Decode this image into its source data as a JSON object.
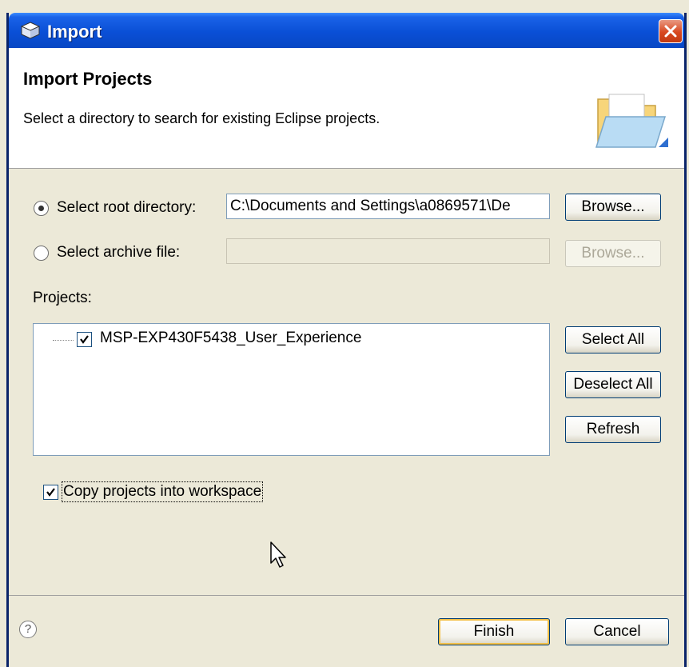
{
  "window": {
    "title": "Import",
    "close_label": "×"
  },
  "header": {
    "title": "Import Projects",
    "description": "Select a directory to search for existing Eclipse projects."
  },
  "source": {
    "root_directory": {
      "label": "Select root directory:",
      "selected": true,
      "value": "C:\\Documents and Settings\\a0869571\\De",
      "browse_label": "Browse..."
    },
    "archive_file": {
      "label": "Select archive file:",
      "selected": false,
      "value": "",
      "browse_label": "Browse..."
    }
  },
  "projects": {
    "label": "Projects:",
    "items": [
      {
        "name": "MSP-EXP430F5438_User_Experience",
        "checked": true
      }
    ],
    "select_all_label": "Select All",
    "deselect_all_label": "Deselect All",
    "refresh_label": "Refresh"
  },
  "options": {
    "copy_into_workspace": {
      "label": "Copy projects into workspace",
      "checked": true
    }
  },
  "footer": {
    "help_label": "?",
    "finish_label": "Finish",
    "cancel_label": "Cancel"
  },
  "icons": {
    "title": "import-wizard-icon",
    "close": "close-icon",
    "banner": "folder-icon",
    "help": "help-icon",
    "cursor": "mouse-pointer-icon"
  },
  "colors": {
    "titlebar": "#0a4fd6",
    "dialog_bg": "#ece9d8",
    "close_button": "#d8481f",
    "default_button_highlight": "#f4c048"
  }
}
